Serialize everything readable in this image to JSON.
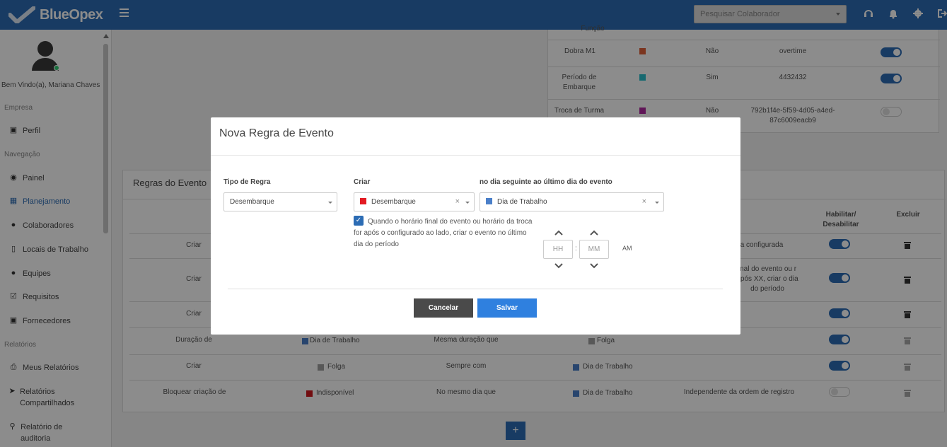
{
  "header": {
    "logo": "BlueOpex",
    "search_placeholder": "Pesquisar Colaborador"
  },
  "sidebar": {
    "welcome": "Bem Vindo(a), Mariana Chaves",
    "sections": [
      "Empresa",
      "Navegação",
      "Relatórios"
    ],
    "items": [
      {
        "label": "Perfil",
        "icon": "briefcase-icon"
      },
      {
        "label": "Painel",
        "icon": "dashboard-icon"
      },
      {
        "label": "Planejamento",
        "icon": "calendar-icon",
        "active": true
      },
      {
        "label": "Colaboradores",
        "icon": "users-icon"
      },
      {
        "label": "Locais de Trabalho",
        "icon": "building-icon"
      },
      {
        "label": "Equipes",
        "icon": "team-icon"
      },
      {
        "label": "Requisitos",
        "icon": "checkbox-icon"
      },
      {
        "label": "Fornecedores",
        "icon": "truck-icon"
      },
      {
        "label": "Meus Relatórios",
        "icon": "print-icon"
      },
      {
        "label": "Relatórios Compartilhados",
        "icon": "share-icon"
      },
      {
        "label": "Relatório de auditoria",
        "icon": "search-icon"
      }
    ]
  },
  "top_table": {
    "partial_text": "Função",
    "rows": [
      {
        "name": "Dobra M1",
        "color": "#e0623a",
        "flag": "Não",
        "code": "overtime",
        "enabled": true
      },
      {
        "name": "Período de Embarque",
        "color": "#2bbfcc",
        "flag": "Sim",
        "code": "4432432",
        "enabled": true
      },
      {
        "name": "Troca de Turma",
        "color": "#b0279f",
        "flag": "Não",
        "code": "792b1f4e-5f59-4d05-a4ed-87c6009eacb9",
        "enabled": false
      }
    ]
  },
  "rules_card": {
    "title": "Regras do Evento",
    "headers": {
      "enable": "Habilitar/ Desabilitar",
      "delete": "Excluir"
    },
    "rows": [
      {
        "action": "Criar",
        "right_text": "a configurada",
        "enabled": true,
        "can_delete": true
      },
      {
        "action": "Criar",
        "right_text": "inal do evento ou r após XX, criar o dia do período",
        "enabled": true,
        "can_delete": true
      },
      {
        "action": "Criar",
        "enabled": true,
        "can_delete": true
      },
      {
        "action": "Duração de",
        "event": "Dia de Trabalho",
        "event_color": "#4a7fc9",
        "relation": "Mesma duração que",
        "target": "Folga",
        "target_color": "#a0a0a0",
        "enabled": true,
        "can_delete": false
      },
      {
        "action": "Criar",
        "event": "Folga",
        "event_color": "#a0a0a0",
        "relation": "Sempre com",
        "target": "Dia de Trabalho",
        "target_color": "#4a7fc9",
        "enabled": true,
        "can_delete": false
      },
      {
        "action": "Bloquear criação de",
        "event": "Indisponível",
        "event_color": "#d0181e",
        "relation": "No mesmo dia que",
        "target": "Dia de Trabalho",
        "target_color": "#4a7fc9",
        "extra": "Independente da ordem de registro",
        "enabled": false,
        "can_delete": false
      }
    ],
    "add_label": "+"
  },
  "modal": {
    "title": "Nova Regra de Evento",
    "labels": {
      "rule_type": "Tipo de Regra",
      "create": "Criar",
      "condition": "no dia seguinte ao último dia do evento"
    },
    "rule_type_value": "Desembarque",
    "create_value": "Desembarque",
    "create_color": "#e31b23",
    "condition_value": "Dia de Trabalho",
    "condition_color": "#4a7fc9",
    "checkbox_checked": true,
    "checkbox_text": "Quando o horário final do evento ou horário da troca for após o configurado ao lado, criar o evento no último dia do período",
    "hour_placeholder": "HH",
    "minute_placeholder": "MM",
    "ampm": "AM",
    "colon": ":",
    "cancel_label": "Cancelar",
    "save_label": "Salvar",
    "cancel_color": "#4a4a4a",
    "save_color": "#2f80df"
  }
}
